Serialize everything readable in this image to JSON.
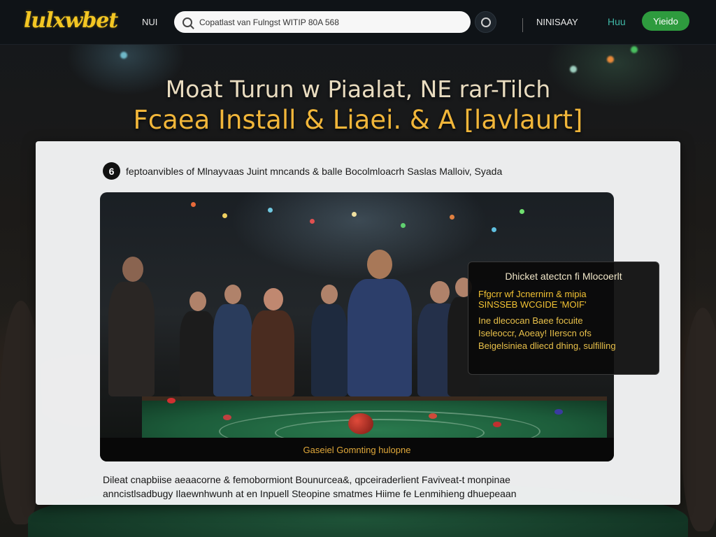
{
  "header": {
    "logo": "lulxwbet",
    "nav_link": "NUI",
    "search_value": "Copatlast van Fulngst WITIP 80A 568",
    "search_icon": "search-icon",
    "circle_icon": "circle-icon",
    "account_link": "NINISAAY",
    "login_link": "Huu",
    "signup_label": "Yieido"
  },
  "hero": {
    "line1": "Moat Turun w Piaalat, NE rar-Tilch",
    "line2": "Fcaea Install & Liaei. & A [lavlaurt]"
  },
  "panel": {
    "info_icon_glyph": "6",
    "info_text": "feptoanvibles of   Mlnayvaas  Juint  mncands & balle Bocolmloacrh  Saslas  Malloiv,  Syada",
    "scene_caption": "Gaseiel Gomnting hulopne",
    "overlay": {
      "title": "Dhicket atectcn fi Mlocoerlt",
      "line1": "Ffgcrr wf Jcnernirn & mipia",
      "line2": "SINSSEB WCGIDE 'MOIF'",
      "body1": "Ine dlecocan Baee focuite",
      "body2": "Iseleoccr, Aoeay! IIerscn ofs",
      "body3": "Beigelsiniea dliecd dhing, sulfilling"
    },
    "desc_line1": "Dileat cnapbiise aeaacorne & femobormiont Bounurcea&, qpceiraderlient Faviveat-t monpinae",
    "desc_line2": "anncistlsadbugy Ilaewnhwunh at en Inpuell Steopine smatmes Hiime fe Lenmihieng dhuepeaan"
  }
}
